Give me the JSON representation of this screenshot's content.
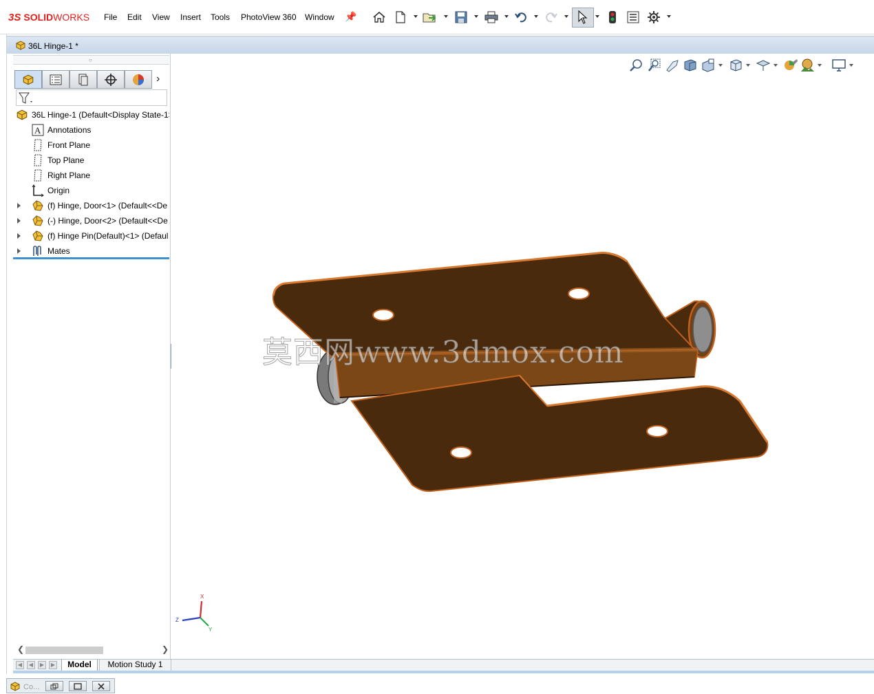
{
  "app": {
    "logo_ds": "3S",
    "logo_solid": "SOLID",
    "logo_works": "WORKS",
    "brand_color": "#e0211b"
  },
  "menu": {
    "items": [
      "File",
      "Edit",
      "View",
      "Insert",
      "Tools",
      "PhotoView 360",
      "Window"
    ]
  },
  "toolbar": {
    "icons": [
      "home-icon",
      "new-document-icon",
      "open-icon",
      "save-icon",
      "print-icon",
      "undo-icon",
      "redo-icon",
      "select-icon",
      "traffic-light-icon",
      "file-properties-icon",
      "options-gear-icon"
    ]
  },
  "document": {
    "title": "36L Hinge-1 *"
  },
  "feature_tree": {
    "tabs": [
      "featuremanager-tab",
      "propertymanager-tab",
      "configurationmanager-tab",
      "dimxpert-tab",
      "display-manager-tab"
    ],
    "root": "36L Hinge-1  (Default<Display State-1>",
    "items": [
      {
        "label": "Annotations",
        "icon": "annotations-icon",
        "expandable": false
      },
      {
        "label": "Front Plane",
        "icon": "plane-icon",
        "expandable": false
      },
      {
        "label": "Top Plane",
        "icon": "plane-icon",
        "expandable": false
      },
      {
        "label": "Right Plane",
        "icon": "plane-icon",
        "expandable": false
      },
      {
        "label": "Origin",
        "icon": "origin-icon",
        "expandable": false
      },
      {
        "label": "(f) Hinge, Door<1> (Default<<De",
        "icon": "part-icon",
        "expandable": true
      },
      {
        "label": "(-) Hinge, Door<2> (Default<<De",
        "icon": "part-icon",
        "expandable": true
      },
      {
        "label": "(f) Hinge Pin(Default)<1> (Defaul",
        "icon": "part-icon",
        "expandable": true
      },
      {
        "label": "Mates",
        "icon": "mates-icon",
        "expandable": true
      }
    ]
  },
  "bottom_tabs": {
    "model": "Model",
    "motion": "Motion Study 1"
  },
  "minimized": {
    "title": "Co..."
  },
  "viewport": {
    "watermark": "莫西网www.3dmox.com",
    "triad": {
      "x": "X",
      "y": "Y",
      "z": "Z"
    },
    "model_color": "#4a2a0c",
    "edge_color": "#c0621e"
  }
}
